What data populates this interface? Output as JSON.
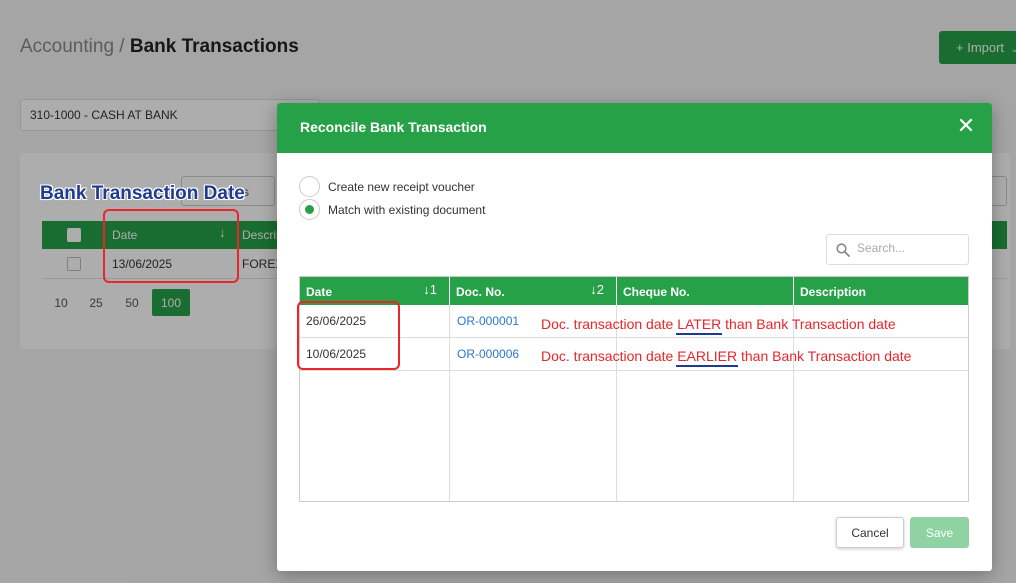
{
  "breadcrumb": {
    "parent": "Accounting",
    "separator": " / ",
    "current": "Bank Transactions"
  },
  "import_button": {
    "label": "+ Import",
    "chevron": "chevron-down-icon"
  },
  "account": {
    "value": "310-1000 - CASH AT BANK"
  },
  "background_table": {
    "rules_label": "ules",
    "columns": {
      "date": "Date",
      "date_sort": "↓",
      "description": "Descrip"
    },
    "row": {
      "date": "13/06/2025",
      "description": "FOREX"
    },
    "page_sizes": [
      "10",
      "25",
      "50",
      "100"
    ],
    "active_page_size": "100"
  },
  "annotation_bg": {
    "label": "Bank Transaction Date"
  },
  "modal": {
    "title": "Reconcile Bank Transaction",
    "close_icon": "close-icon",
    "options": [
      {
        "label": "Create new receipt voucher",
        "checked": false
      },
      {
        "label": "Match with existing document",
        "checked": true
      }
    ],
    "search": {
      "placeholder": "Search...",
      "icon": "search-icon"
    },
    "columns": [
      {
        "label": "Date",
        "sort": "↓1"
      },
      {
        "label": "Doc. No.",
        "sort": "↓2"
      },
      {
        "label": "Cheque No.",
        "sort": ""
      },
      {
        "label": "Description",
        "sort": ""
      }
    ],
    "rows": [
      {
        "date": "26/06/2025",
        "doc_no": "OR-000001",
        "cheque_no": "",
        "description": ""
      },
      {
        "date": "10/06/2025",
        "doc_no": "OR-000006",
        "cheque_no": "",
        "description": ""
      }
    ],
    "notes": [
      {
        "before": "Doc. transaction date ",
        "keyword": "LATER",
        "after": " than Bank Transaction date"
      },
      {
        "before": "Doc. transaction date ",
        "keyword": "EARLIER",
        "after": " than Bank Transaction date"
      }
    ],
    "buttons": {
      "cancel": "Cancel",
      "save": "Save"
    }
  },
  "colors": {
    "accent": "#26a148",
    "annotation_red": "#e8262b",
    "annotation_blue": "#1d3b8f",
    "link": "#2a77c9"
  }
}
